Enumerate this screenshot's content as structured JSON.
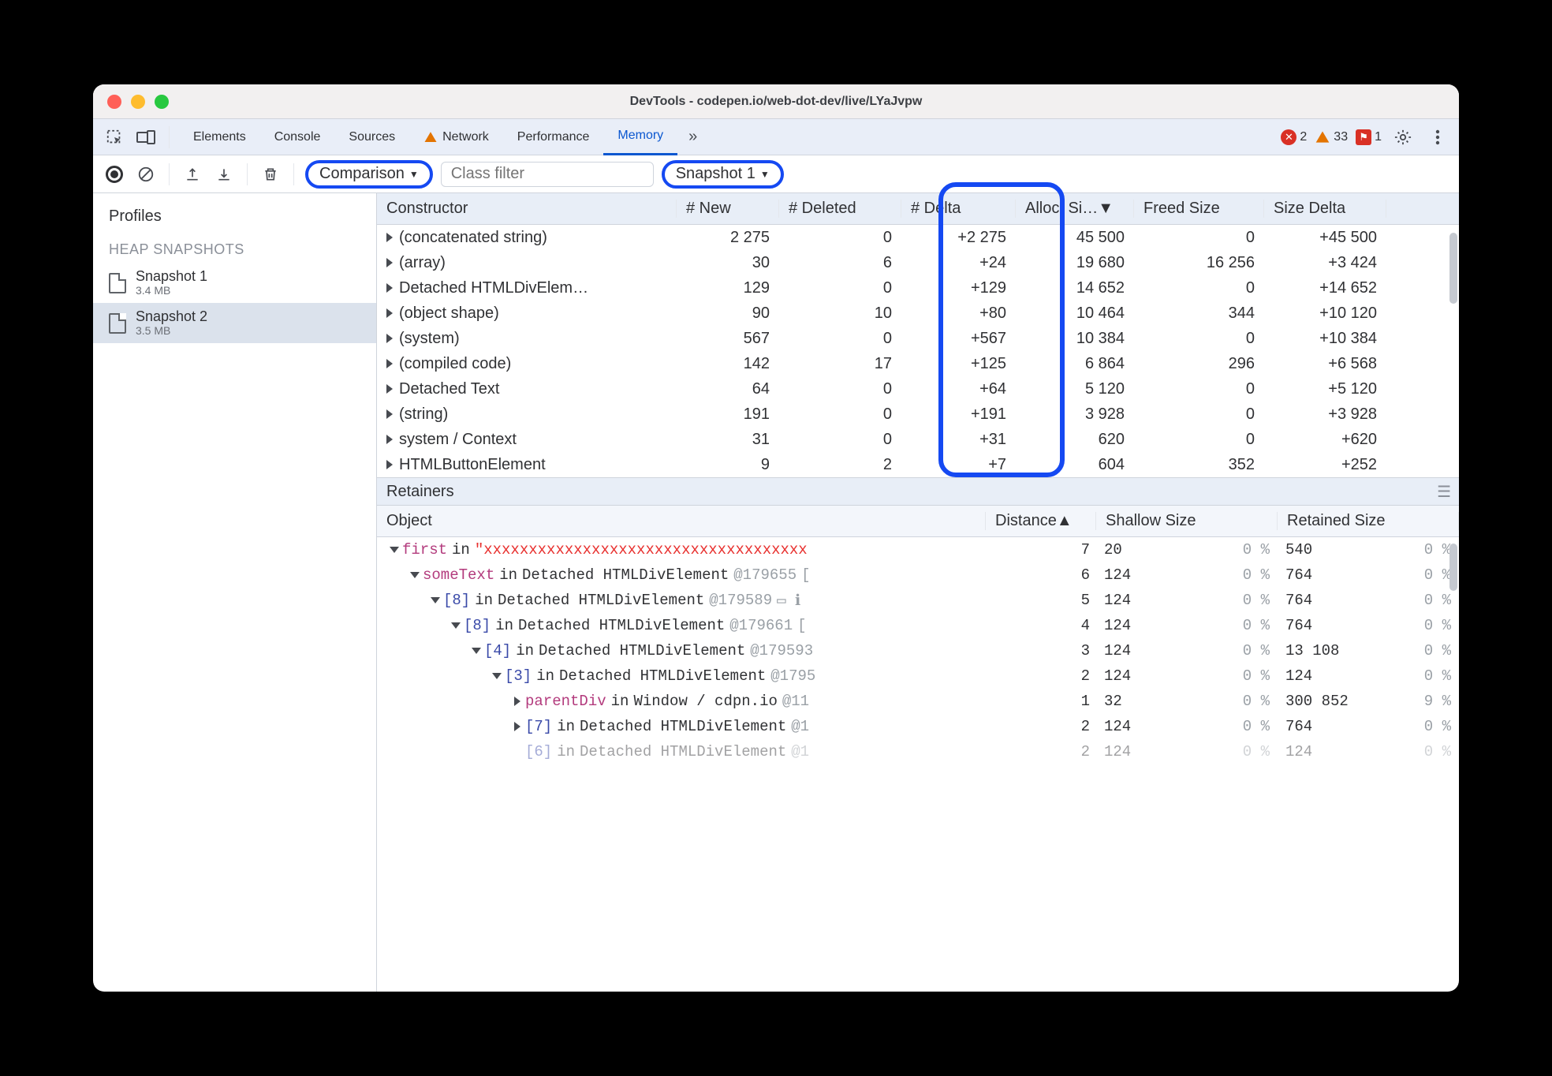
{
  "window": {
    "title": "DevTools - codepen.io/web-dot-dev/live/LYaJvpw"
  },
  "tabs": {
    "items": [
      "Elements",
      "Console",
      "Sources",
      "Network",
      "Performance",
      "Memory"
    ],
    "active_index": 5,
    "more_glyph": "»",
    "warnings": {
      "errors": 2,
      "warnings": 33,
      "issues": 1
    }
  },
  "memtoolbar": {
    "view_label": "Comparison",
    "filter_placeholder": "Class filter",
    "compare_to": "Snapshot 1"
  },
  "sidebar": {
    "title": "Profiles",
    "section": "HEAP SNAPSHOTS",
    "snapshots": [
      {
        "name": "Snapshot 1",
        "size": "3.4 MB"
      },
      {
        "name": "Snapshot 2",
        "size": "3.5 MB"
      }
    ],
    "selected_index": 1
  },
  "diff": {
    "columns": [
      "Constructor",
      "# New",
      "# Deleted",
      "# Delta",
      "Alloc. Si…",
      "Freed Size",
      "Size Delta"
    ],
    "alloc_sorted_desc": true,
    "rows": [
      {
        "name": "(concatenated string)",
        "new": "2 275",
        "del": "0",
        "delta": "+2 275",
        "alloc": "45 500",
        "freed": "0",
        "sdelta": "+45 500"
      },
      {
        "name": "(array)",
        "new": "30",
        "del": "6",
        "delta": "+24",
        "alloc": "19 680",
        "freed": "16 256",
        "sdelta": "+3 424"
      },
      {
        "name": "Detached HTMLDivElem…",
        "new": "129",
        "del": "0",
        "delta": "+129",
        "alloc": "14 652",
        "freed": "0",
        "sdelta": "+14 652"
      },
      {
        "name": "(object shape)",
        "new": "90",
        "del": "10",
        "delta": "+80",
        "alloc": "10 464",
        "freed": "344",
        "sdelta": "+10 120"
      },
      {
        "name": "(system)",
        "new": "567",
        "del": "0",
        "delta": "+567",
        "alloc": "10 384",
        "freed": "0",
        "sdelta": "+10 384"
      },
      {
        "name": "(compiled code)",
        "new": "142",
        "del": "17",
        "delta": "+125",
        "alloc": "6 864",
        "freed": "296",
        "sdelta": "+6 568"
      },
      {
        "name": "Detached Text",
        "new": "64",
        "del": "0",
        "delta": "+64",
        "alloc": "5 120",
        "freed": "0",
        "sdelta": "+5 120"
      },
      {
        "name": "(string)",
        "new": "191",
        "del": "0",
        "delta": "+191",
        "alloc": "3 928",
        "freed": "0",
        "sdelta": "+3 928"
      },
      {
        "name": "system / Context",
        "new": "31",
        "del": "0",
        "delta": "+31",
        "alloc": "620",
        "freed": "0",
        "sdelta": "+620"
      },
      {
        "name": "HTMLButtonElement",
        "new": "9",
        "del": "2",
        "delta": "+7",
        "alloc": "604",
        "freed": "352",
        "sdelta": "+252"
      }
    ]
  },
  "retainers": {
    "title": "Retainers",
    "columns": [
      "Object",
      "Distance",
      "Shallow Size",
      "Retained Size"
    ],
    "rows": [
      {
        "indent": 0,
        "open": true,
        "key": "first",
        "in": " in ",
        "str": "\"xxxxxxxxxxxxxxxxxxxxxxxxxxxxxxxxxxxx",
        "dist": "7",
        "ssize": "20",
        "spct": "0 %",
        "rsize": "540",
        "rpct": "0 %"
      },
      {
        "indent": 1,
        "open": true,
        "key": "someText",
        "in": " in ",
        "type": "Detached HTMLDivElement",
        "at": " @179655 ",
        "tail": "[",
        "dist": "6",
        "ssize": "124",
        "spct": "0 %",
        "rsize": "764",
        "rpct": "0 %"
      },
      {
        "indent": 2,
        "open": true,
        "idx": "[8]",
        "in": " in ",
        "type": "Detached HTMLDivElement",
        "at": " @179589 ",
        "tail": "▭ ℹ",
        "dist": "5",
        "ssize": "124",
        "spct": "0 %",
        "rsize": "764",
        "rpct": "0 %"
      },
      {
        "indent": 3,
        "open": true,
        "idx": "[8]",
        "in": " in ",
        "type": "Detached HTMLDivElement",
        "at": " @179661 ",
        "tail": "[",
        "dist": "4",
        "ssize": "124",
        "spct": "0 %",
        "rsize": "764",
        "rpct": "0 %"
      },
      {
        "indent": 4,
        "open": true,
        "idx": "[4]",
        "in": " in ",
        "type": "Detached HTMLDivElement",
        "at": " @179593",
        "tail": "",
        "dist": "3",
        "ssize": "124",
        "spct": "0 %",
        "rsize": "13 108",
        "rpct": "0 %"
      },
      {
        "indent": 5,
        "open": true,
        "idx": "[3]",
        "in": " in ",
        "type": "Detached HTMLDivElement",
        "at": " @1795",
        "tail": "",
        "dist": "2",
        "ssize": "124",
        "spct": "0 %",
        "rsize": "124",
        "rpct": "0 %"
      },
      {
        "indent": 6,
        "open": false,
        "key": "parentDiv",
        "in": " in ",
        "type": "Window / cdpn.io",
        "at": " @11",
        "tail": "",
        "dist": "1",
        "ssize": "32",
        "spct": "0 %",
        "rsize": "300 852",
        "rpct": "9 %"
      },
      {
        "indent": 6,
        "open": false,
        "idx": "[7]",
        "in": " in ",
        "type": "Detached HTMLDivElement",
        "at": " @1",
        "tail": "",
        "dist": "2",
        "ssize": "124",
        "spct": "0 %",
        "rsize": "764",
        "rpct": "0 %"
      },
      {
        "indent": 6,
        "muted": true,
        "idx": "[6]",
        "in": " in ",
        "type": "Detached HTMLDivElement",
        "at": " @1",
        "tail": "",
        "dist": "2",
        "ssize": "124",
        "spct": "0 %",
        "rsize": "124",
        "rpct": "0 %"
      }
    ]
  }
}
